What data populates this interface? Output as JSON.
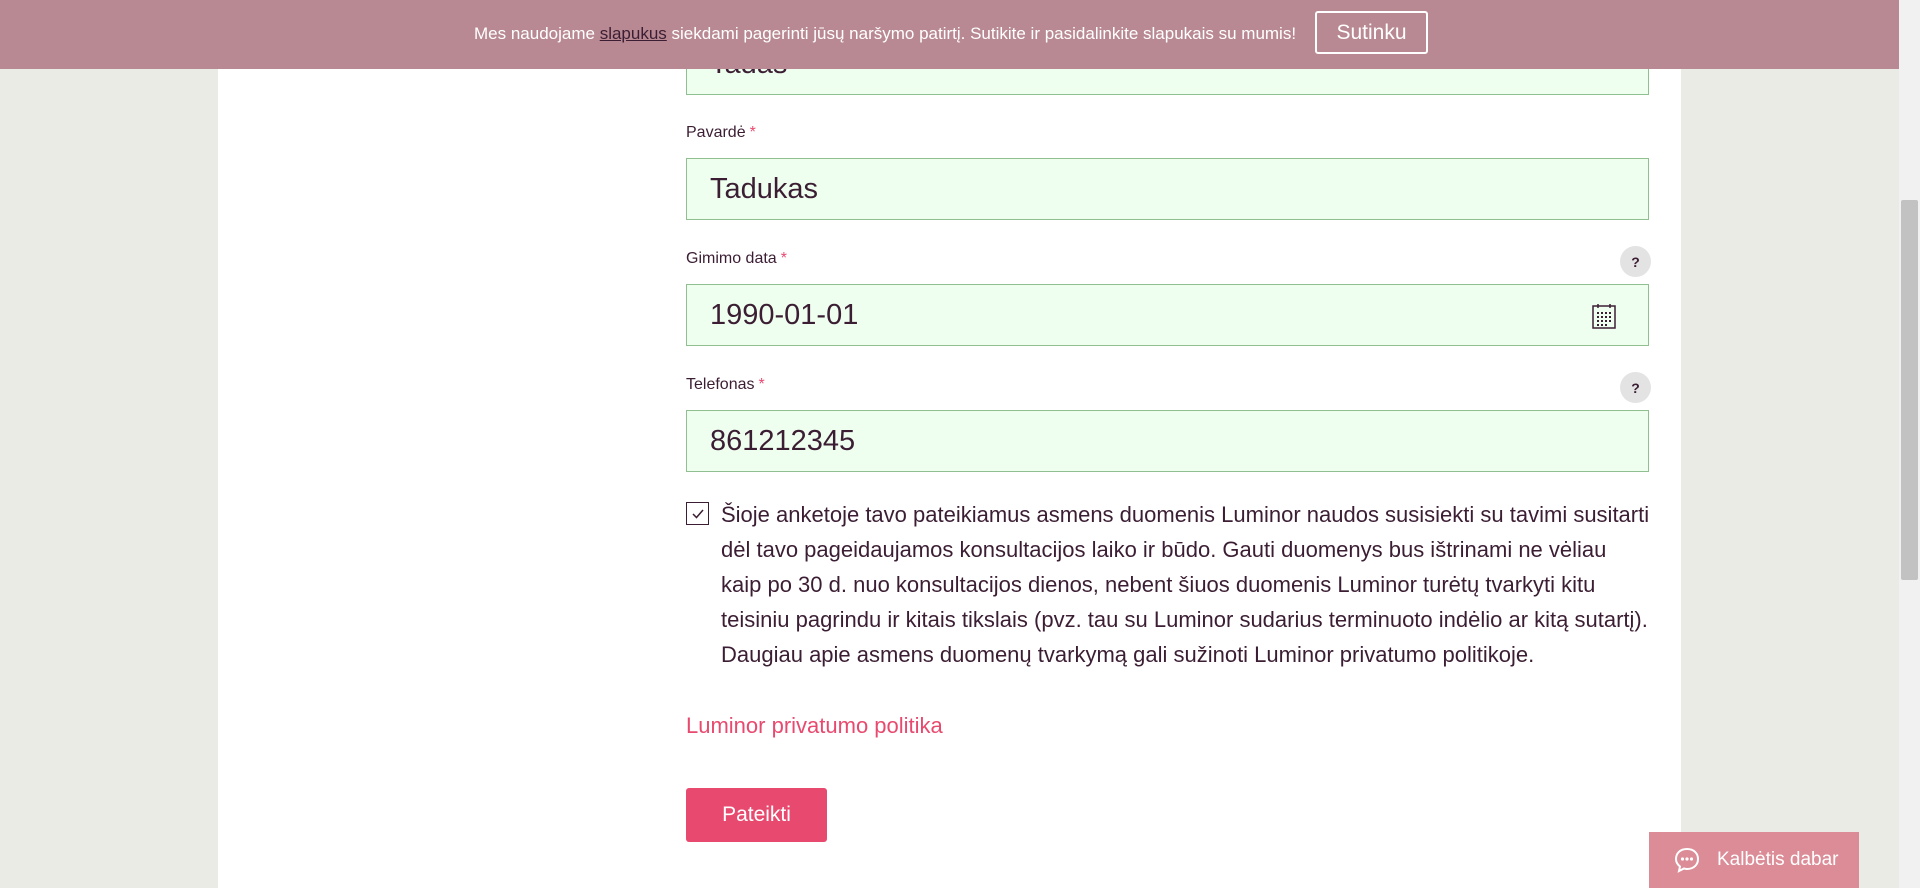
{
  "cookie_bar": {
    "text_before": "Mes naudojame ",
    "link": "slapukus",
    "text_after": " siekdami pagerinti jūsų naršymo patirtį. Sutikite ir pasidalinkite slapukais su mumis!",
    "accept_label": "Sutinku"
  },
  "form": {
    "first_name": {
      "value": "Tadas"
    },
    "last_name": {
      "label": "Pavardė",
      "required": "*",
      "value": "Tadukas"
    },
    "birth_date": {
      "label": "Gimimo data",
      "required": "*",
      "value": "1990-01-01",
      "help": "?"
    },
    "phone": {
      "label": "Telefonas",
      "required": "*",
      "value": "861212345",
      "help": "?"
    },
    "consent": {
      "checked": true,
      "text": "Šioje anketoje tavo pateikiamus asmens duomenis Luminor naudos susisiekti su tavimi susitarti dėl tavo pageidaujamos konsultacijos laiko ir būdo. Gauti duomenys bus ištrinami ne vėliau kaip po 30 d. nuo konsultacijos dienos, nebent šiuos duomenis Luminor turėtų tvarkyti kitu teisiniu pagrindu ir kitais tikslais (pvz. tau su Luminor sudarius terminuoto indėlio ar kitą sutartį). Daugiau apie asmens duomenų tvarkymą gali sužinoti Luminor privatumo politikoje."
    },
    "privacy_link": "Luminor privatumo politika",
    "submit_label": "Pateikti"
  },
  "chat": {
    "label": "Kalbėtis dabar",
    "icon": "chat-bubble-icon"
  },
  "colors": {
    "accent": "#e84a6f",
    "cookie_bar": "#b88992",
    "input_bg": "#efffef",
    "input_border": "#90c090",
    "text": "#3b1e33",
    "chat_bg": "#db8c97"
  }
}
